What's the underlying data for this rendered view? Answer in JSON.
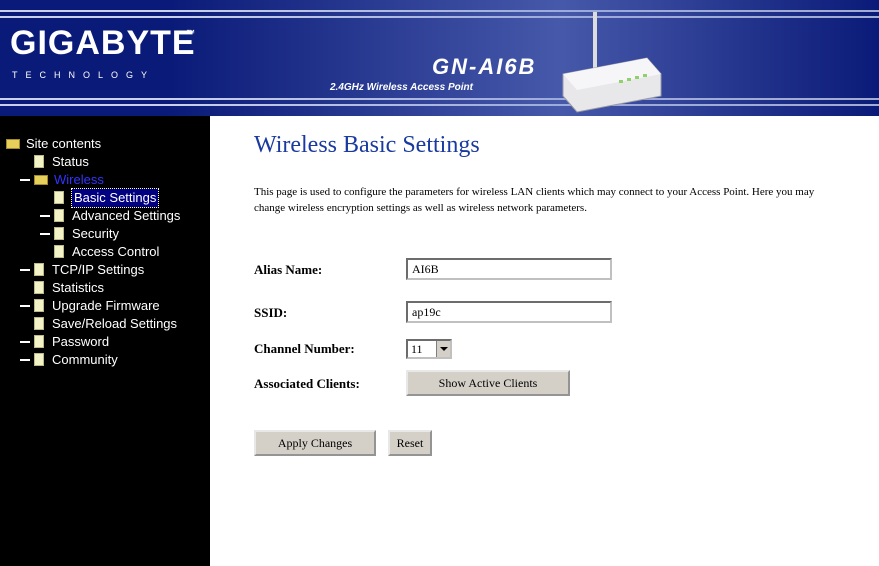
{
  "header": {
    "brand": "GIGABYTE",
    "brand_tm": "™",
    "brand_sub": "TECHNOLOGY",
    "model": "GN-AI6B",
    "model_desc": "2.4GHz Wireless Access Point"
  },
  "sidebar": {
    "root": "Site contents",
    "items": [
      {
        "label": "Status",
        "level": 1,
        "icon": "document-icon"
      },
      {
        "label": "Wireless",
        "level": 1,
        "icon": "folder-icon"
      },
      {
        "label": "Basic Settings",
        "level": 2,
        "icon": "document-icon",
        "selected": true
      },
      {
        "label": "Advanced Settings",
        "level": 2,
        "icon": "document-icon"
      },
      {
        "label": "Security",
        "level": 2,
        "icon": "document-icon"
      },
      {
        "label": "Access Control",
        "level": 2,
        "icon": "document-icon"
      },
      {
        "label": "TCP/IP Settings",
        "level": 1,
        "icon": "document-icon"
      },
      {
        "label": "Statistics",
        "level": 1,
        "icon": "document-icon"
      },
      {
        "label": "Upgrade Firmware",
        "level": 1,
        "icon": "document-icon"
      },
      {
        "label": "Save/Reload Settings",
        "level": 1,
        "icon": "document-icon"
      },
      {
        "label": "Password",
        "level": 1,
        "icon": "document-icon"
      },
      {
        "label": "Community",
        "level": 1,
        "icon": "document-icon"
      }
    ]
  },
  "main": {
    "title": "Wireless Basic Settings",
    "description": "This page is used to configure the parameters for wireless LAN clients which may connect to your Access Point. Here you may change wireless encryption settings as well as wireless network parameters.",
    "fields": {
      "alias_label": "Alias Name:",
      "alias_value": "AI6B",
      "ssid_label": "SSID:",
      "ssid_value": "ap19c",
      "channel_label": "Channel Number:",
      "channel_value": "11",
      "clients_label": "Associated Clients:",
      "show_clients_button": "Show Active Clients"
    },
    "apply_button": "Apply Changes",
    "reset_button": "Reset"
  },
  "colors": {
    "header_bg": "#0a1a78",
    "sidebar_bg": "#000000",
    "title_color": "#1a3aa0"
  }
}
